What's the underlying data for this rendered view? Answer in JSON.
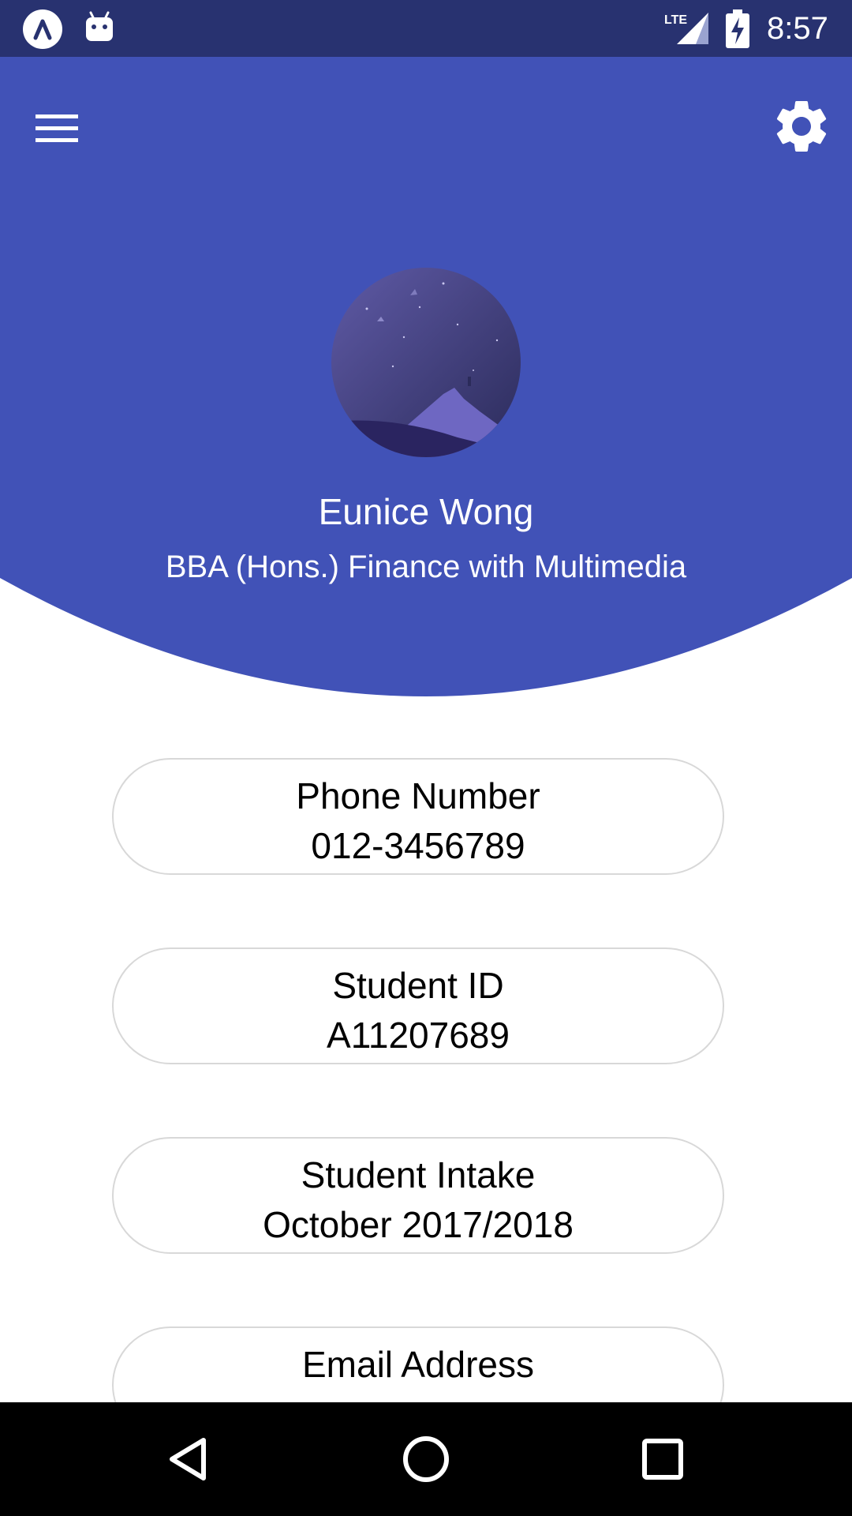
{
  "status_bar": {
    "time": "8:57",
    "network_label": "LTE",
    "icons": [
      "app-icon",
      "android-icon",
      "lte-signal-icon",
      "battery-charging-icon"
    ]
  },
  "colors": {
    "status_bar": "#283270",
    "header": "#4152B7",
    "card_border": "#d8d8d8",
    "nav_bar": "#000000"
  },
  "toolbar": {
    "menu_icon": "hamburger-menu-icon",
    "settings_icon": "gear-icon"
  },
  "profile": {
    "name": "Eunice Wong",
    "program": "BBA (Hons.) Finance with Multimedia"
  },
  "cards": [
    {
      "label": "Phone Number",
      "value": "012-3456789"
    },
    {
      "label": "Student ID",
      "value": "A11207689"
    },
    {
      "label": "Student Intake",
      "value": "October 2017/2018"
    },
    {
      "label": "Email Address",
      "value": ""
    }
  ],
  "nav": {
    "icons": [
      "back-icon",
      "home-icon",
      "recents-icon"
    ]
  }
}
